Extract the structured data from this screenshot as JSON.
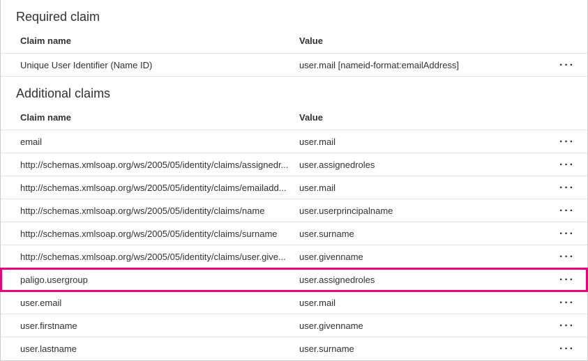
{
  "required": {
    "title": "Required claim",
    "header_name": "Claim name",
    "header_value": "Value",
    "rows": [
      {
        "name": "Unique User Identifier (Name ID)",
        "value": "user.mail [nameid-format:emailAddress]",
        "actions": true
      }
    ]
  },
  "additional": {
    "title": "Additional claims",
    "header_name": "Claim name",
    "header_value": "Value",
    "rows": [
      {
        "name": "email",
        "value": "user.mail",
        "actions": true,
        "highlight": false
      },
      {
        "name": "http://schemas.xmlsoap.org/ws/2005/05/identity/claims/assignedr...",
        "value": "user.assignedroles",
        "actions": true,
        "highlight": false
      },
      {
        "name": "http://schemas.xmlsoap.org/ws/2005/05/identity/claims/emailadd...",
        "value": "user.mail",
        "actions": true,
        "highlight": false
      },
      {
        "name": "http://schemas.xmlsoap.org/ws/2005/05/identity/claims/name",
        "value": "user.userprincipalname",
        "actions": true,
        "highlight": false
      },
      {
        "name": "http://schemas.xmlsoap.org/ws/2005/05/identity/claims/surname",
        "value": "user.surname",
        "actions": true,
        "highlight": false
      },
      {
        "name": "http://schemas.xmlsoap.org/ws/2005/05/identity/claims/user.give...",
        "value": "user.givenname",
        "actions": true,
        "highlight": false
      },
      {
        "name": "paligo.usergroup",
        "value": "user.assignedroles",
        "actions": true,
        "highlight": true
      },
      {
        "name": "user.email",
        "value": "user.mail",
        "actions": true,
        "highlight": false
      },
      {
        "name": "user.firstname",
        "value": "user.givenname",
        "actions": true,
        "highlight": false
      },
      {
        "name": "user.lastname",
        "value": "user.surname",
        "actions": true,
        "highlight": false
      }
    ]
  },
  "more_label": "···"
}
